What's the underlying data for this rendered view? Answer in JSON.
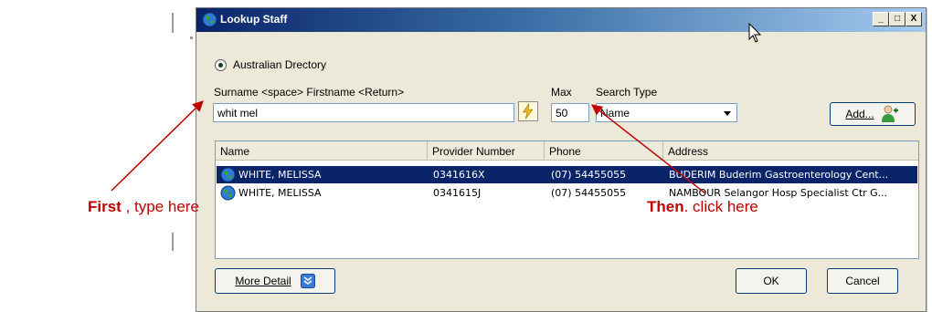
{
  "window": {
    "title": "Lookup Staff",
    "controls": {
      "minimize": "_",
      "maximize": "□",
      "close": "X"
    }
  },
  "search": {
    "directory_option": "Australian Drectory",
    "query_label": "Surname <space> Firstname <Return>",
    "query_value": "whit mel",
    "max_label": "Max",
    "max_value": "50",
    "search_type_label": "Search Type",
    "search_type_value": "Name"
  },
  "buttons": {
    "add": "Add...",
    "more_detail": "More Detail",
    "ok": "OK",
    "cancel": "Cancel"
  },
  "results": {
    "columns": [
      "Name",
      "Provider Number",
      "Phone",
      "Address"
    ],
    "rows": [
      {
        "name": "WHITE, MELISSA",
        "provider": "0341616X",
        "phone": "(07) 54455055",
        "address": "BUDERIM Buderim Gastroenterology Cent...",
        "selected": true
      },
      {
        "name": "WHITE, MELISSA",
        "provider": "0341615J",
        "phone": "(07) 54455055",
        "address": "NAMBOUR Selangor Hosp Specialist Ctr G...",
        "selected": false
      }
    ]
  },
  "annotations": {
    "first_bold": "First",
    "first_rest": " , type here",
    "then_bold": "Then",
    "then_rest": ". click here"
  },
  "colors": {
    "selection": "#0a246a",
    "annotation": "#c00000",
    "dialog_bg": "#ece9d8"
  }
}
